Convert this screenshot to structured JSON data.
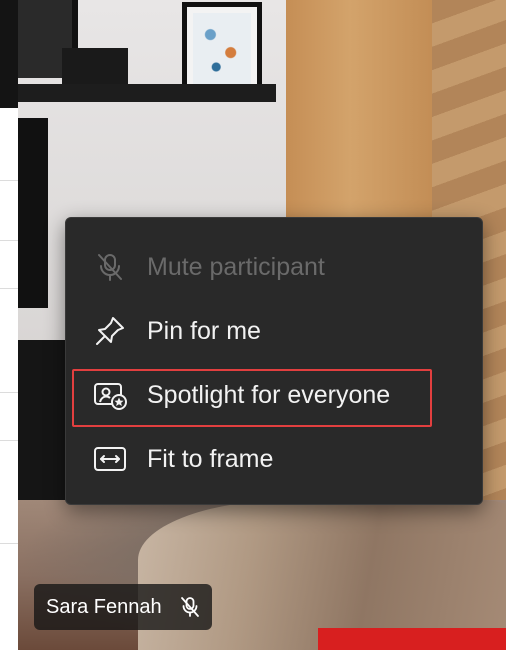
{
  "menu": {
    "items": [
      {
        "label": "Mute participant",
        "icon": "mic-off-icon",
        "disabled": true
      },
      {
        "label": "Pin for me",
        "icon": "pin-icon",
        "disabled": false
      },
      {
        "label": "Spotlight for everyone",
        "icon": "spotlight-icon",
        "disabled": false,
        "highlighted": true
      },
      {
        "label": "Fit to frame",
        "icon": "fit-to-frame-icon",
        "disabled": false
      }
    ],
    "highlight_color": "#e23f3f"
  },
  "participant": {
    "name": "Sara Fennah",
    "status_icon": "mic-off-icon"
  }
}
